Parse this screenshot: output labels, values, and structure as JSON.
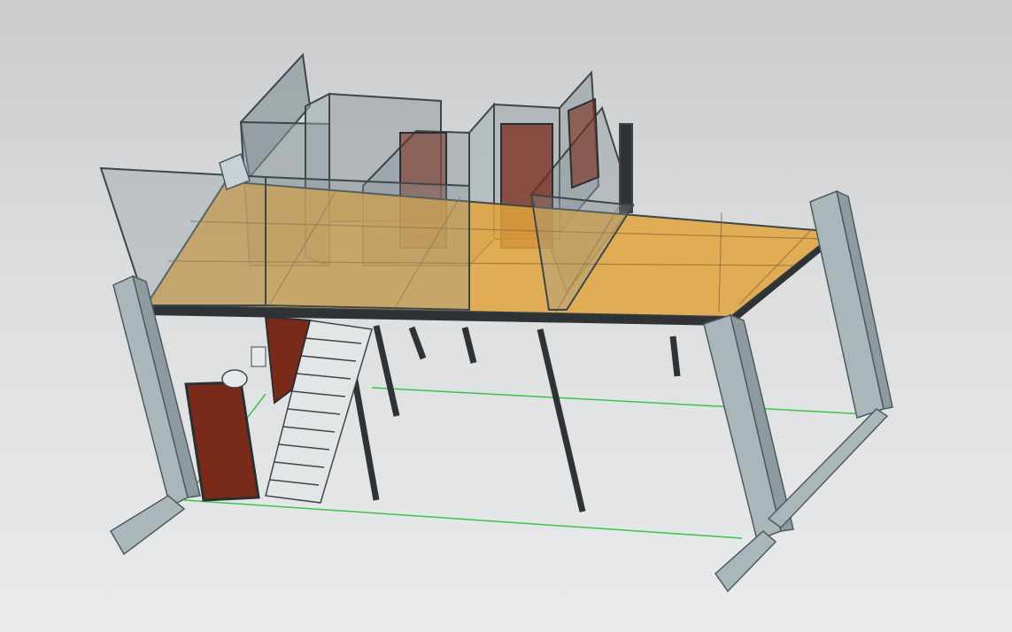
{
  "viewport": {
    "background_top": "#c9cbcd",
    "background_bottom": "#e9eaeb"
  },
  "model": {
    "colors": {
      "column": "#a9b7bb",
      "column_shade": "#8d9a9f",
      "column_top": "#c6d2d5",
      "deck": "#e1a33c",
      "deck_grid": "#8a6a3a",
      "glass": "#8d989d",
      "glass_edge": "#3f4649",
      "door": "#7a2a18",
      "door_frame": "#2b2f33",
      "steel": "#2f3336",
      "stair": "#c8cccd",
      "ground_line": "#3fc24a"
    }
  }
}
